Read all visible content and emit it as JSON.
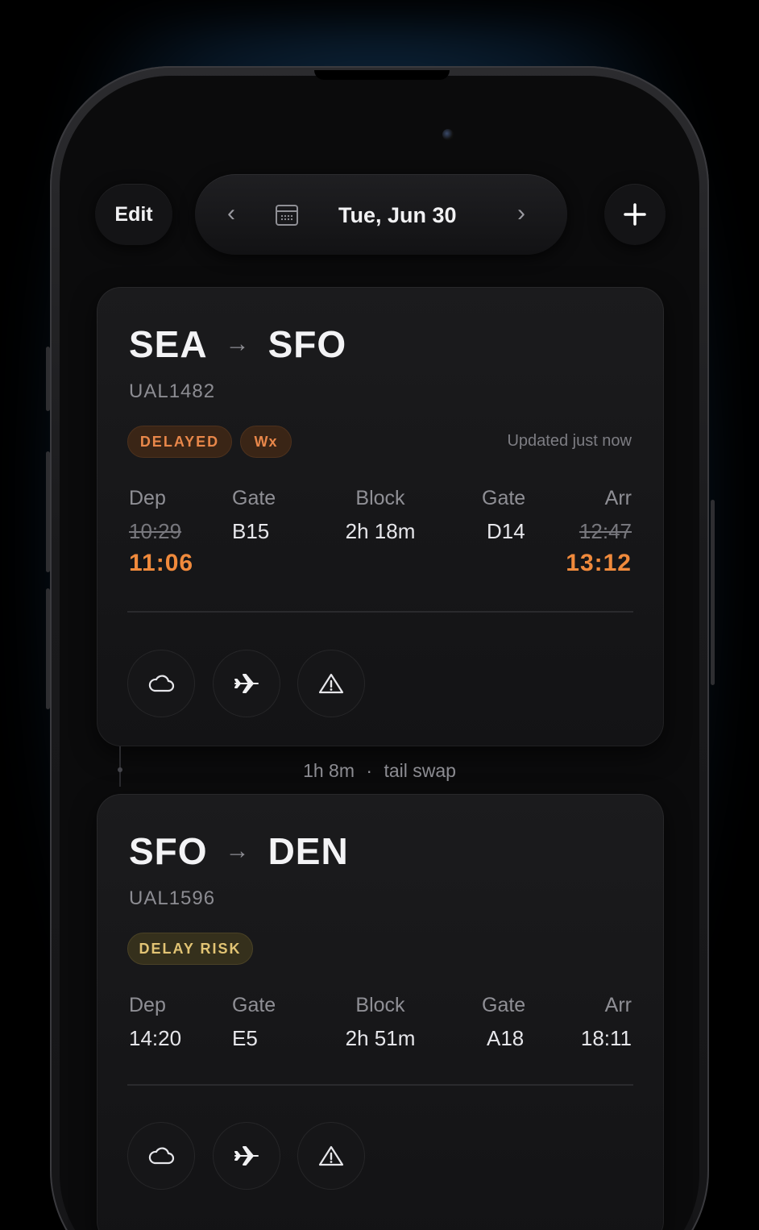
{
  "toolbar": {
    "edit_label": "Edit",
    "date_label": "Tue, Jun 30",
    "prev_icon": "chevron-left-icon",
    "next_icon": "chevron-right-icon",
    "calendar_icon": "calendar-icon",
    "add_icon": "plus-icon"
  },
  "flights": [
    {
      "origin": "SEA",
      "destination": "SFO",
      "flight_number": "UAL1482",
      "badges": [
        "DELAYED",
        "Wx"
      ],
      "updated": "Updated just now",
      "dep_label": "Dep",
      "dep_sched": "10:29",
      "dep_new": "11:06",
      "gate_dep_label": "Gate",
      "gate_dep": "B15",
      "block_label": "Block",
      "block": "2h 18m",
      "gate_arr_label": "Gate",
      "gate_arr": "D14",
      "arr_label": "Arr",
      "arr_sched": "12:47",
      "arr_new": "13:12",
      "actions": [
        "cloud-icon",
        "airplane-icon",
        "warning-icon"
      ]
    },
    {
      "origin": "SFO",
      "destination": "DEN",
      "flight_number": "UAL1596",
      "badges": [
        "DELAY RISK"
      ],
      "dep_label": "Dep",
      "dep": "14:20",
      "gate_dep_label": "Gate",
      "gate_dep": "E5",
      "block_label": "Block",
      "block": "2h 51m",
      "gate_arr_label": "Gate",
      "gate_arr": "A18",
      "arr_label": "Arr",
      "arr": "18:11",
      "actions": [
        "cloud-icon",
        "airplane-icon",
        "warning-icon"
      ]
    }
  ],
  "connection": {
    "duration": "1h 8m",
    "separator": "·",
    "note": "tail swap"
  },
  "colors": {
    "delayed": "#f08a3c",
    "delay_risk": "#e2c474",
    "background": "#0b0b0c",
    "glow": "#286eaa"
  }
}
